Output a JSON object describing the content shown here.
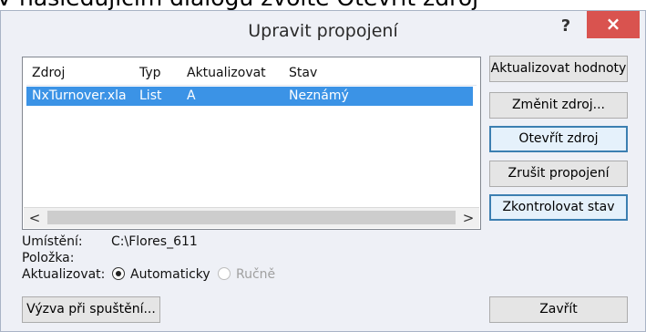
{
  "doc_text": "V následujícím dialogu zvolte Otevřít zdroj",
  "dialog": {
    "title": "Upravit propojení",
    "help": "?",
    "close": "×"
  },
  "table": {
    "headers": [
      "Zdroj",
      "Typ",
      "Aktualizovat",
      "Stav"
    ],
    "rows": [
      {
        "zdroj": "NxTurnover.xla",
        "typ": "List",
        "aktualizovat": "A",
        "stav": "Neznámý"
      }
    ],
    "scroll_left": "<",
    "scroll_right": ">"
  },
  "buttons": {
    "update_values": "Aktualizovat hodnoty",
    "change_source": "Změnit zdroj...",
    "open_source": "Otevřít zdroj",
    "break_link": "Zrušit propojení",
    "check_status": "Zkontrolovat stav"
  },
  "details": {
    "location_label": "Umístění:",
    "location_value": "C:\\Flores_611",
    "item_label": "Položka:",
    "update_label": "Aktualizovat:",
    "auto_label": "Automaticky",
    "manual_label": "Ručně"
  },
  "bottom": {
    "startup_prompt": "Výzva při spuštění...",
    "close": "Zavřít"
  }
}
